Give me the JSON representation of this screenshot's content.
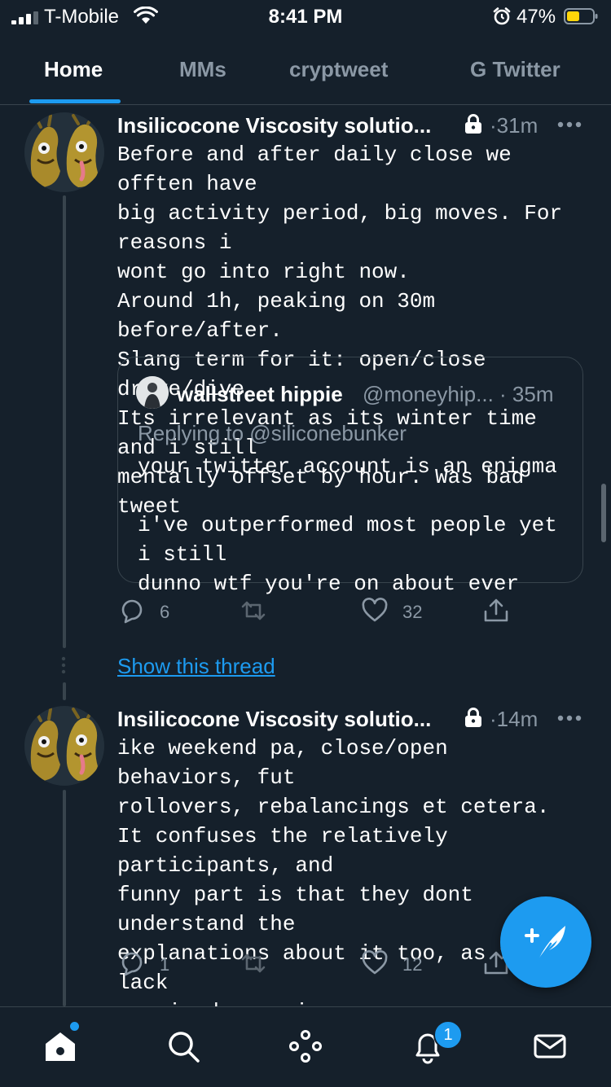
{
  "status_bar": {
    "carrier": "T-Mobile",
    "time": "8:41 PM",
    "battery_percent": "47%",
    "icons": [
      "signal-icon",
      "wifi-icon",
      "alarm-icon",
      "battery-icon"
    ]
  },
  "tabs": [
    {
      "label": "Home",
      "active": true
    },
    {
      "label": "MMs",
      "active": false
    },
    {
      "label": "cryptweet",
      "active": false
    },
    {
      "label": "G Twitter",
      "active": false
    }
  ],
  "tweets": [
    {
      "name": "Insilicocone Viscosity solutio...",
      "time": "31m",
      "text": "Before and after daily close we offten have\nbig activity period, big moves. For reasons i\nwont go into right now.\nAround 1h, peaking on 30m before/after.\nSlang term for it: open/close drive/dive\nIts irrelevant as its winter time and i still\nmentally offset by hour. Was bad tweet",
      "quote": {
        "name": "wallstreet hippie",
        "handle": "@moneyhip... · 35m",
        "replying_to": "Replying to @siliconebunker",
        "text": "your twitter account is an enigma\n\ni've outperformed most people yet i still\ndunno wtf you're on about ever"
      },
      "replies": "6",
      "retweets": "",
      "likes": "32"
    },
    {
      "name": "Insilicocone Viscosity solutio...",
      "time": "14m",
      "text": "ike weekend pa, close/open behaviors, fut\nrollovers, rebalancings et cetera.\nIt confuses the relatively participants, and\nfunny part is that they dont understand the\nexplanations about it too, as they lack\nrequired experience.\nTime fixes this tho, if u survive long en",
      "replies": "1",
      "retweets": "",
      "likes": "12"
    }
  ],
  "show_thread": "Show this thread",
  "meta_separator": "·",
  "notifications_badge": "1",
  "colors": {
    "background": "#15202b",
    "accent": "#1d9bf0",
    "secondary_text": "#8b98a5",
    "border": "#38444d"
  },
  "bottom_nav": [
    "home-icon",
    "search-icon",
    "spaces-icon",
    "notifications-icon",
    "messages-icon"
  ]
}
